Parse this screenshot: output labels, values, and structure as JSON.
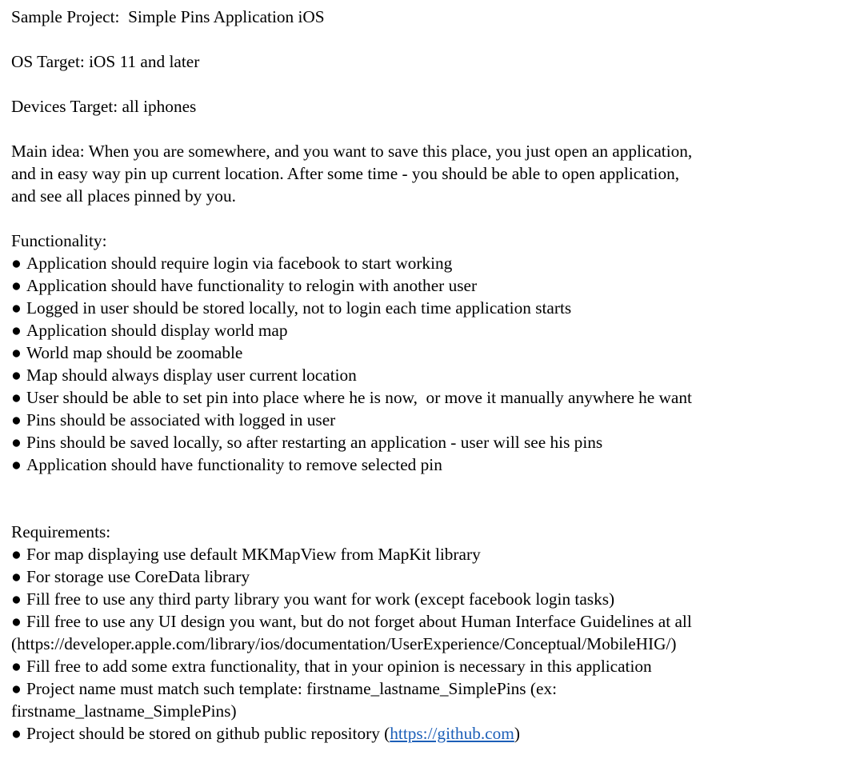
{
  "header": {
    "project": "Sample Project:  Simple Pins Application iOS",
    "os_target": "OS Target: iOS 11 and later",
    "devices_target": "Devices Target: all iphones"
  },
  "main_idea": {
    "line1": "Main idea: When you are somewhere, and you want to save this place, you just open an application,",
    "line2": "and in easy way pin up current location. After some time - you should be able to open application,",
    "line3": "and see all places pinned by you."
  },
  "functionality": {
    "heading": "Functionality:",
    "bullet_char": "●",
    "items": [
      "Application should require login via facebook to start working",
      "Application should have functionality to relogin with another user",
      "Logged in user should be stored locally, not to login each time application starts",
      "Application should display world map",
      "World map should be zoomable",
      "Map should always display user current location",
      "User should be able to set pin into place where he is now,  or move it manually anywhere he want",
      "Pins should be associated with logged in user",
      "Pins should be saved locally, so after restarting an application - user will see his pins",
      "Application should have functionality to remove selected pin"
    ]
  },
  "requirements": {
    "heading": "Requirements:",
    "bullet_char": "●",
    "item1": "For map displaying use default MKMapView from MapKit library",
    "item2": "For storage use CoreData library",
    "item3": "Fill free to use any third party library you want for work (except facebook login tasks)",
    "item4": "Fill free to use any UI design you want, but do not forget about Human Interface Guidelines at all",
    "item4_cont": "(https://developer.apple.com/library/ios/documentation/UserExperience/Conceptual/MobileHIG/)",
    "item5": "Fill free to add some extra functionality, that in your opinion is necessary in this application",
    "item6": "Project name must match such template: firstname_lastname_SimplePins (ex:",
    "item6_cont": "firstname_lastname_SimplePins)",
    "item7_prefix": "Project should be stored on github public repository (",
    "item7_link": "https://github.com",
    "item7_suffix": ")"
  },
  "colors": {
    "text": "#000000",
    "link": "#1c5fb8",
    "background": "#ffffff"
  }
}
